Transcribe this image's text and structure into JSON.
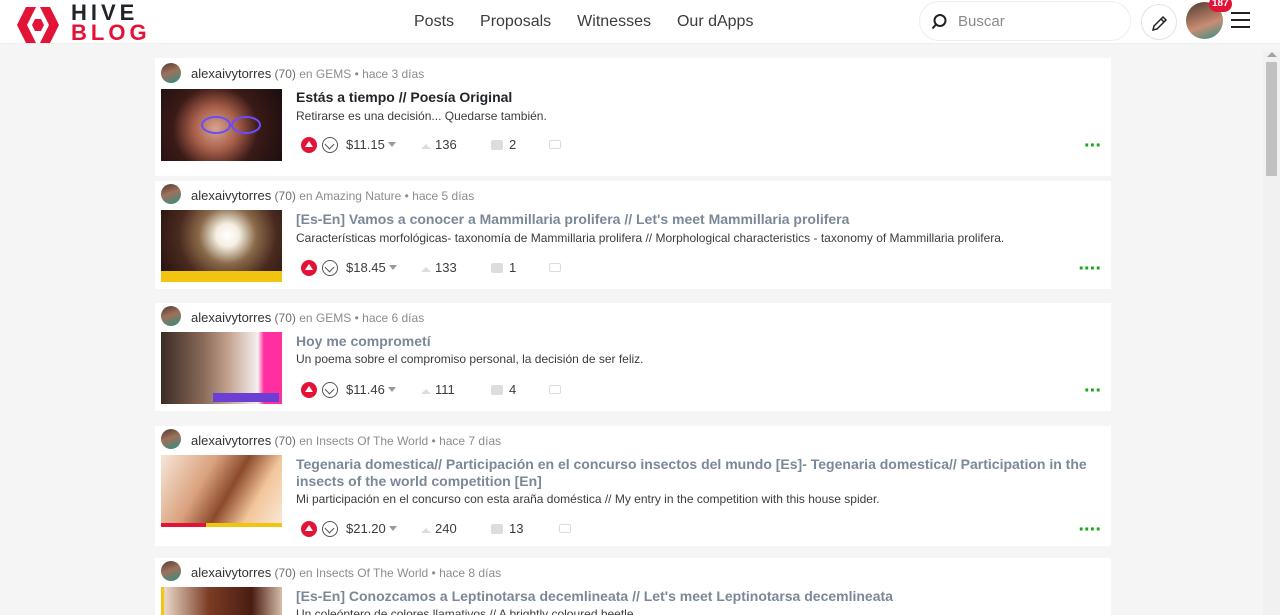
{
  "header": {
    "logo_top": "HIVE",
    "logo_bottom": "BLOG",
    "nav": [
      "Posts",
      "Proposals",
      "Witnesses",
      "Our dApps"
    ],
    "search_placeholder": "Buscar",
    "notifications": "187"
  },
  "posts": [
    {
      "author": "alexaivytorres",
      "rep": "(70)",
      "community": "en GEMS",
      "time": "• hace 3 días",
      "title": "Estás a tiempo // Poesía Original",
      "desc": "Retirarse es una decisión... Quedarse también.",
      "payout": "$11.15",
      "votes": "136",
      "comments": "2",
      "visited": false
    },
    {
      "author": "alexaivytorres",
      "rep": "(70)",
      "community": "en Amazing Nature",
      "time": "• hace 5 días",
      "title": "[Es-En] Vamos a conocer a Mammillaria prolifera // Let's meet Mammillaria prolifera",
      "desc": "Características morfológicas- taxonomía de Mammillaria prolifera // Morphological characteristics - taxonomy of Mammillaria prolifera.",
      "payout": "$18.45",
      "votes": "133",
      "comments": "1",
      "visited": true
    },
    {
      "author": "alexaivytorres",
      "rep": "(70)",
      "community": "en GEMS",
      "time": "• hace 6 días",
      "title": "Hoy me comprometí",
      "desc": "Un poema sobre el compromiso personal, la decisión de ser feliz.",
      "payout": "$11.46",
      "votes": "111",
      "comments": "4",
      "visited": true
    },
    {
      "author": "alexaivytorres",
      "rep": "(70)",
      "community": "en Insects Of The World",
      "time": "• hace 7 días",
      "title": "Tegenaria domestica// Participación en el concurso insectos del mundo [Es]- Tegenaria domestica// Participation in the insects of the world competition [En]",
      "desc": "Mi participación en el concurso con esta araña doméstica // My entry in the competition with this house spider.",
      "payout": "$21.20",
      "votes": "240",
      "comments": "13",
      "visited": true
    },
    {
      "author": "alexaivytorres",
      "rep": "(70)",
      "community": "en Insects Of The World",
      "time": "• hace 8 días",
      "title": "[Es-En] Conozcamos a Leptinotarsa decemlineata // Let's meet Leptinotarsa decemlineata",
      "desc": "Un coleóptero de colores llamativos // A brightly coloured beetle",
      "visited": true
    }
  ],
  "colors": {
    "brand": "#e31337",
    "visited_title": "#7b8897",
    "more": "#1ba51b"
  }
}
